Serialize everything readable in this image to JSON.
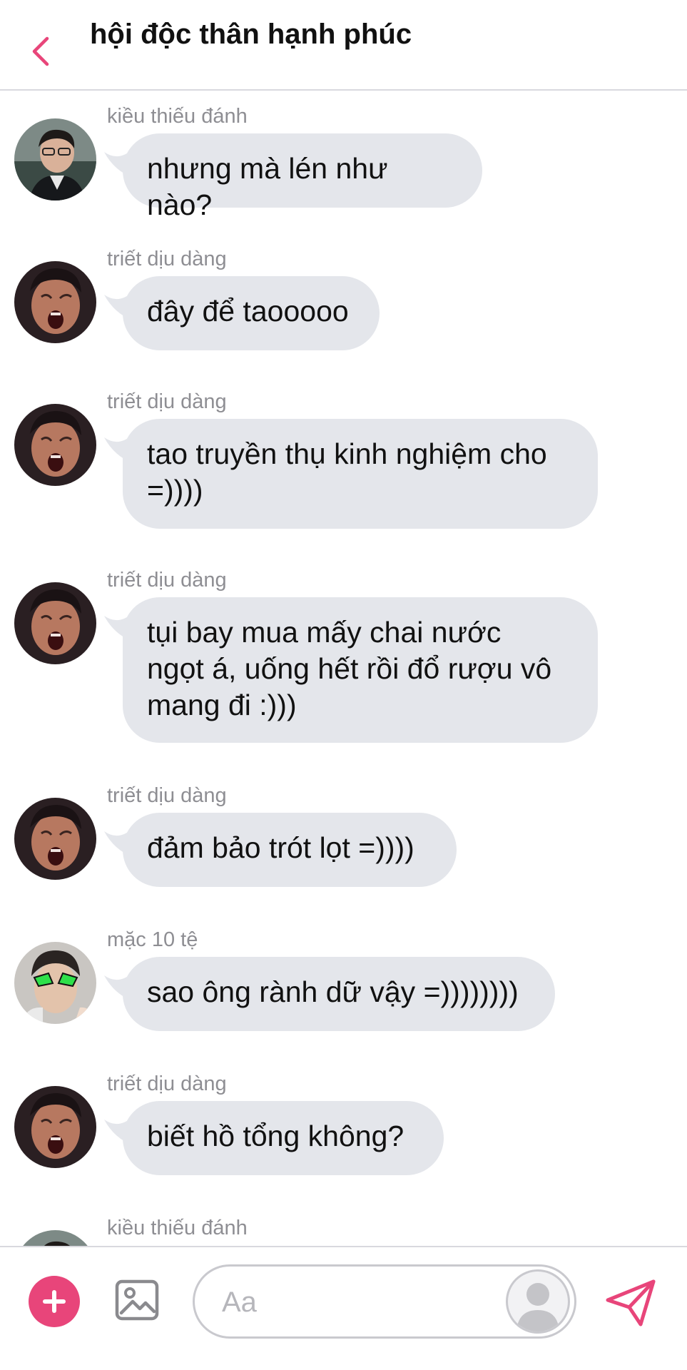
{
  "colors": {
    "accent": "#e8457a",
    "bubble": "#e4e6eb",
    "sender_name": "#8e8e93",
    "divider": "#d9d9de"
  },
  "header": {
    "back_icon": "chevron-left-icon",
    "title": "hội độc thân hạnh phúc"
  },
  "messages": [
    {
      "sender": "kiều thiếu đánh",
      "avatar": "avatar-kieu",
      "lines": [
        "nhưng mà lén như nào?"
      ]
    },
    {
      "sender": "triết dịu dàng",
      "avatar": "avatar-triet",
      "lines": [
        "đây để taooooo"
      ]
    },
    {
      "sender": "triết dịu dàng",
      "avatar": "avatar-triet",
      "lines": [
        "tao truyền thụ kinh nghiệm cho",
        "=))))"
      ]
    },
    {
      "sender": "triết dịu dàng",
      "avatar": "avatar-triet",
      "lines": [
        "tụi bay mua mấy chai nước",
        "ngọt á, uống hết rồi đổ rượu vô",
        "mang đi :)))"
      ]
    },
    {
      "sender": "triết dịu dàng",
      "avatar": "avatar-triet",
      "lines": [
        "đảm bảo trót lọt =))))"
      ]
    },
    {
      "sender": "mặc 10 tệ",
      "avatar": "avatar-mac",
      "lines": [
        "sao ông rành dữ vậy =))))))))"
      ]
    },
    {
      "sender": "triết dịu dàng",
      "avatar": "avatar-triet",
      "lines": [
        "biết hồ tổng không?"
      ]
    },
    {
      "sender": "kiều thiếu đánh",
      "avatar": "avatar-kieu",
      "lines": []
    }
  ],
  "composer": {
    "plus_icon": "plus-icon",
    "image_icon": "image-icon",
    "placeholder": "Aa",
    "sticker_icon": "profile-silhouette-icon",
    "send_icon": "send-icon"
  }
}
